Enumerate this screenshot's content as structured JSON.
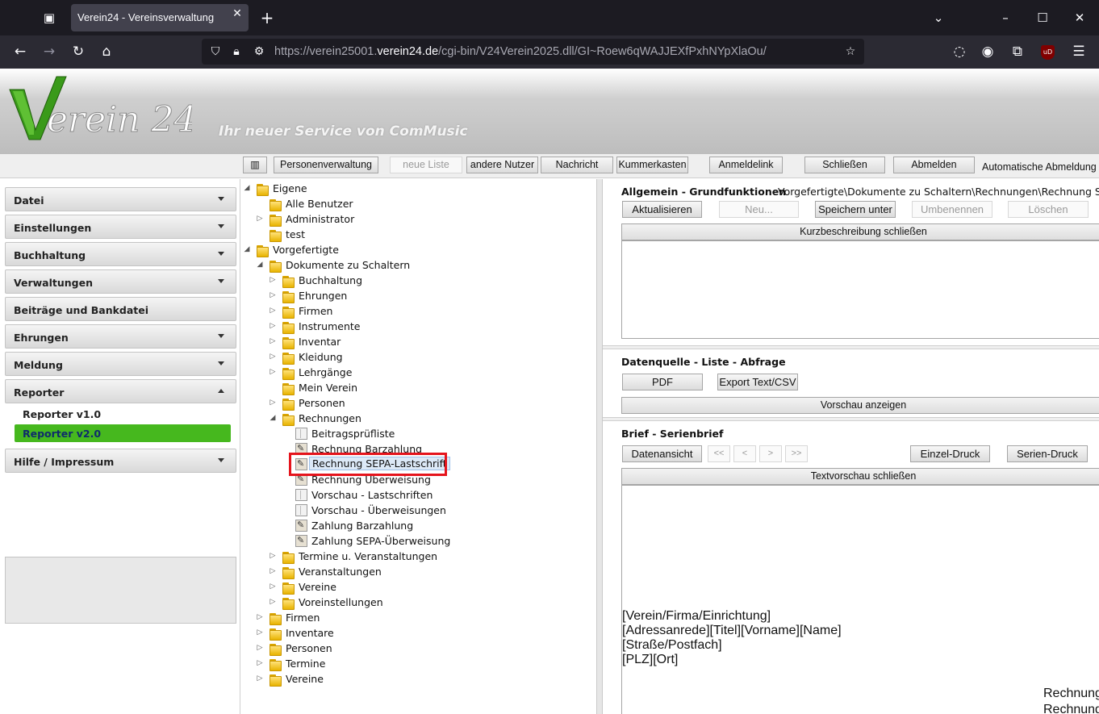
{
  "browser": {
    "tab_title": "Verein24 - Vereinsverwaltung",
    "url_prefix": "https://verein25001.",
    "url_domain": "verein24.de",
    "url_path": "/cgi-bin/V24Verein2025.dll/GI~Roew6qWAJJEXfPxhNYpXlaOu/",
    "ublock_badge": "uD"
  },
  "header": {
    "logo_text": "Verein 24",
    "tagline": "Ihr neuer Service von ComMusic"
  },
  "toolbar": {
    "personenverwaltung": "Personenverwaltung",
    "neue_liste": "neue Liste",
    "andere_nutzer": "andere Nutzer",
    "nachricht": "Nachricht",
    "kummerkasten": "Kummerkasten",
    "anmeldelink": "Anmeldelink",
    "schliessen": "Schließen",
    "abmelden": "Abmelden",
    "auto_abmeldung": "Automatische Abmeldung"
  },
  "menu": {
    "datei": "Datei",
    "einstellungen": "Einstellungen",
    "buchhaltung": "Buchhaltung",
    "verwaltungen": "Verwaltungen",
    "beitraege": "Beiträge und Bankdatei",
    "ehrungen": "Ehrungen",
    "meldung": "Meldung",
    "reporter": "Reporter",
    "reporter_v1": "Reporter v1.0",
    "reporter_v2": "Reporter v2.0",
    "hilfe": "Hilfe / Impressum"
  },
  "tree": [
    {
      "label": "Eigene",
      "icon": "folder",
      "exp": "open"
    },
    {
      "label": "Alle Benutzer",
      "icon": "folder",
      "exp": ""
    },
    {
      "label": "Administrator",
      "icon": "folder",
      "exp": "closed"
    },
    {
      "label": "test",
      "icon": "folder",
      "exp": ""
    },
    {
      "label": "Vorgefertigte",
      "icon": "folder",
      "exp": "open"
    },
    {
      "label": "Dokumente zu Schaltern",
      "icon": "folder",
      "exp": "open"
    },
    {
      "label": "Buchhaltung",
      "icon": "folder",
      "exp": "closed"
    },
    {
      "label": "Ehrungen",
      "icon": "folder",
      "exp": "closed"
    },
    {
      "label": "Firmen",
      "icon": "folder",
      "exp": "closed"
    },
    {
      "label": "Instrumente",
      "icon": "folder",
      "exp": "closed"
    },
    {
      "label": "Inventar",
      "icon": "folder",
      "exp": "closed"
    },
    {
      "label": "Kleidung",
      "icon": "folder",
      "exp": "closed"
    },
    {
      "label": "Lehrgänge",
      "icon": "folder",
      "exp": "closed"
    },
    {
      "label": "Mein Verein",
      "icon": "folder",
      "exp": ""
    },
    {
      "label": "Personen",
      "icon": "folder",
      "exp": "closed"
    },
    {
      "label": "Rechnungen",
      "icon": "folder",
      "exp": "open"
    },
    {
      "label": "Beitragsprüfliste",
      "icon": "doc",
      "exp": ""
    },
    {
      "label": "Rechnung Barzahlung",
      "icon": "report",
      "exp": ""
    },
    {
      "label": "Rechnung SEPA-Lastschrift",
      "icon": "report",
      "exp": ""
    },
    {
      "label": "Rechnung Überweisung",
      "icon": "report",
      "exp": ""
    },
    {
      "label": "Vorschau - Lastschriften",
      "icon": "doc",
      "exp": ""
    },
    {
      "label": "Vorschau - Überweisungen",
      "icon": "doc",
      "exp": ""
    },
    {
      "label": "Zahlung Barzahlung",
      "icon": "report",
      "exp": ""
    },
    {
      "label": "Zahlung SEPA-Überweisung",
      "icon": "report",
      "exp": ""
    },
    {
      "label": "Termine u. Veranstaltungen",
      "icon": "folder",
      "exp": "closed"
    },
    {
      "label": "Veranstaltungen",
      "icon": "folder",
      "exp": "closed"
    },
    {
      "label": "Vereine",
      "icon": "folder",
      "exp": "closed"
    },
    {
      "label": "Voreinstellungen",
      "icon": "folder",
      "exp": "closed"
    },
    {
      "label": "Firmen",
      "icon": "folder",
      "exp": "closed"
    },
    {
      "label": "Inventare",
      "icon": "folder",
      "exp": "closed"
    },
    {
      "label": "Personen",
      "icon": "folder",
      "exp": "closed"
    },
    {
      "label": "Termine",
      "icon": "folder",
      "exp": "closed"
    },
    {
      "label": "Vereine",
      "icon": "folder",
      "exp": "closed"
    }
  ],
  "right": {
    "allgemein_title": "Allgemein - Grundfunktionen",
    "path": "Vorgefertigte\\Dokumente zu Schaltern\\Rechnungen\\Rechnung SEPA-Lastschrift",
    "aktualisieren": "Aktualisieren",
    "neu": "Neu...",
    "speichern_unter": "Speichern unter",
    "umbenennen": "Umbenennen",
    "loeschen": "Löschen",
    "kurzbeschreibung": "Kurzbeschreibung schließen",
    "datenquelle_title": "Datenquelle - Liste - Abfrage",
    "pdf": "PDF",
    "export": "Export Text/CSV",
    "vorschau": "Vorschau anzeigen",
    "brief_title": "Brief - Serienbrief",
    "datenansicht": "Datenansicht",
    "nav_first": "<<",
    "nav_prev": "<",
    "nav_next": ">",
    "nav_last": ">>",
    "einzel_druck": "Einzel-Druck",
    "serien_druck": "Serien-Druck",
    "textvorschau": "Textvorschau schließen",
    "letter_lines": [
      "[Verein/Firma/Einrichtung]",
      "[Adressanrede][Titel][Vorname][Name]",
      "[Straße/Postfach]",
      "[PLZ][Ort]"
    ],
    "letter_right_1": "Rechnung",
    "letter_right_2": "Rechnung"
  }
}
